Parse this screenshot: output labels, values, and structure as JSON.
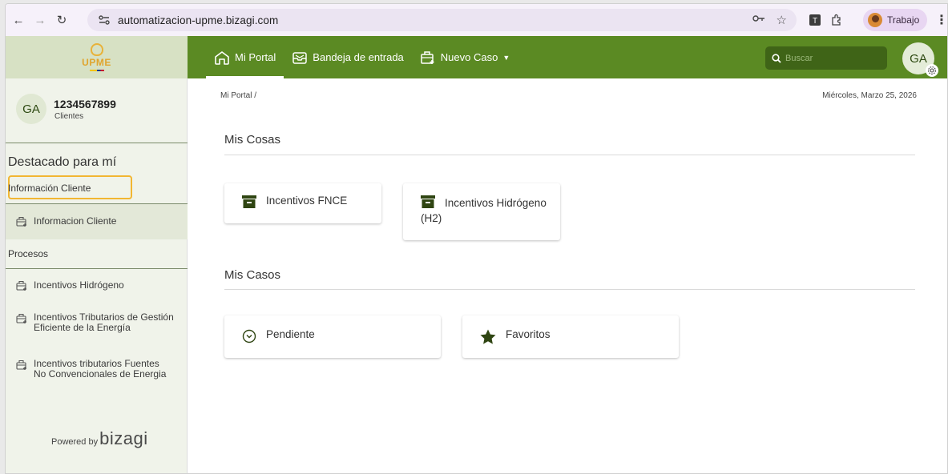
{
  "browser": {
    "url": "automatizacion-upme.bizagi.com",
    "profile_label": "Trabajo",
    "extension_letter": "T"
  },
  "header": {
    "logo_text": "UPME",
    "nav": [
      {
        "label": "Mi Portal",
        "icon": "home-icon",
        "active": true
      },
      {
        "label": "Bandeja de entrada",
        "icon": "inbox-icon",
        "active": false
      },
      {
        "label": "Nuevo Caso",
        "icon": "new-case-icon",
        "active": false,
        "has_dropdown": true
      }
    ],
    "search_placeholder": "Buscar",
    "avatar_initials": "GA"
  },
  "sidebar": {
    "avatar_initials": "GA",
    "user_name": "1234567899",
    "user_role": "Clientes",
    "section_title": "Destacado para mí",
    "group1_label": "Información Cliente",
    "group1_items": [
      "Informacion Cliente"
    ],
    "group2_label": "Procesos",
    "group2_items": [
      "Incentivos Hidrógeno",
      "Incentivos Tributarios de Gestión Eficiente de la Energía",
      "Incentivos tributarios Fuentes No Convencionales de Energia"
    ],
    "powered_by_prefix": "Powered by",
    "powered_by_brand": "bizagi"
  },
  "main": {
    "breadcrumb": "Mi Portal /",
    "date": "Miércoles, Marzo 25, 2026",
    "mis_cosas_title": "Mis Cosas",
    "mis_cosas_cards": [
      "Incentivos FNCE",
      "Incentivos Hidrógeno (H2)"
    ],
    "mis_casos_title": "Mis Casos",
    "mis_casos_cards": [
      "Pendiente",
      "Favoritos"
    ]
  },
  "colors": {
    "header_green": "#5b8a23",
    "sidebar_bg": "#f0f3ea",
    "highlight": "#f2b632",
    "icon_dark": "#2f4512"
  }
}
